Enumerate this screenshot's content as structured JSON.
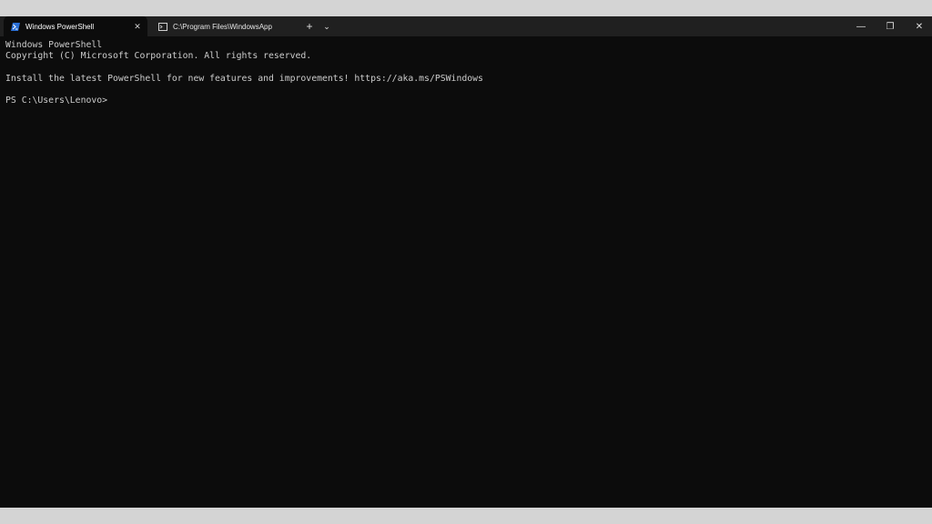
{
  "tabs": [
    {
      "label": "Windows PowerShell",
      "icon": "powershell-icon",
      "active": true
    },
    {
      "label": "C:\\Program Files\\WindowsApp",
      "icon": "console-icon",
      "active": false
    }
  ],
  "titlebar": {
    "new_tab": "+",
    "dropdown": "⌄",
    "minimize": "—",
    "maximize": "❐",
    "close": "✕",
    "tab_close": "✕"
  },
  "terminal": {
    "lines": [
      "Windows PowerShell",
      "Copyright (C) Microsoft Corporation. All rights reserved.",
      "",
      "Install the latest PowerShell for new features and improvements! https://aka.ms/PSWindows",
      "",
      "PS C:\\Users\\Lenovo>"
    ]
  },
  "colors": {
    "terminal_bg": "#0c0c0c",
    "titlebar_bg": "#202020",
    "text": "#cccccc",
    "outer_bg": "#d4d4d4"
  }
}
